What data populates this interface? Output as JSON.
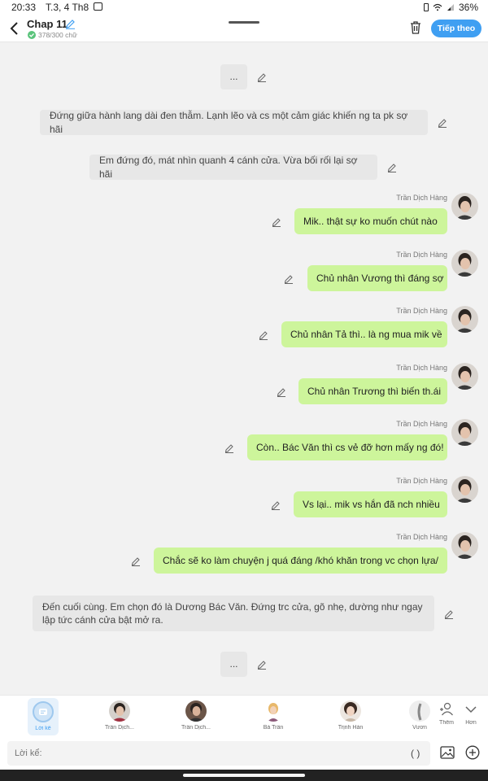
{
  "status": {
    "time": "20:33",
    "date": "T.3, 4 Th8",
    "battery": "36%"
  },
  "header": {
    "title": "Chap 11",
    "word_count": "378/300 chữ",
    "next_label": "Tiếp theo"
  },
  "feed": {
    "narration_1": "...",
    "narration_2": "Đứng giữa hành lang dài đen thẫm. Lạnh lẽo và cs một cảm giác khiến ng ta pk sợ hãi",
    "narration_3": "Em đứng đó, mát nhìn quanh 4 cánh cửa. Vừa bối rối lại sợ hãi",
    "messages": [
      {
        "speaker": "Trần Dịch Hàng",
        "text": "Mik.. thật sự ko muốn chút nào"
      },
      {
        "speaker": "Trần Dịch Hàng",
        "text": "Chủ nhân Vương thì đáng sợ"
      },
      {
        "speaker": "Trần Dịch Hàng",
        "text": "Chủ nhân Tả thì.. là ng mua mik về"
      },
      {
        "speaker": "Trần Dịch Hàng",
        "text": "Chủ nhân Trương thì biến th.ái"
      },
      {
        "speaker": "Trần Dịch Hàng",
        "text": "Còn.. Bác Văn thì cs vẻ đỡ hơn mấy ng đó!"
      },
      {
        "speaker": "Trần Dịch Hàng",
        "text": "Vs lại.. mik vs hắn đã nch nhiều"
      },
      {
        "speaker": "Trần Dịch Hàng",
        "text": "Chắc sẽ ko làm chuyện j quá đáng /khó khăn trong vc chọn lựa/"
      }
    ],
    "narration_4": "Đến cuối cùng. Em chọn đó là Dương Bác Văn. Đứng trc cửa, gõ nhẹ, dường như ngay lập tức cánh cửa bật mở ra.",
    "narration_5": "..."
  },
  "characters": [
    {
      "label": "Lời kể"
    },
    {
      "label": "Trần Dịch..."
    },
    {
      "label": "Trần Dịch..."
    },
    {
      "label": "Bà Trần"
    },
    {
      "label": "Trịnh Hàn"
    },
    {
      "label": "Vươn"
    },
    {
      "label": "Thêm"
    },
    {
      "label": "Hơn"
    }
  ],
  "input": {
    "placeholder": "Lời kể:",
    "paren": "( )"
  },
  "colors": {
    "accent": "#3f9ff2",
    "bubble": "#cdf59b",
    "narration": "#e7e7e7"
  }
}
